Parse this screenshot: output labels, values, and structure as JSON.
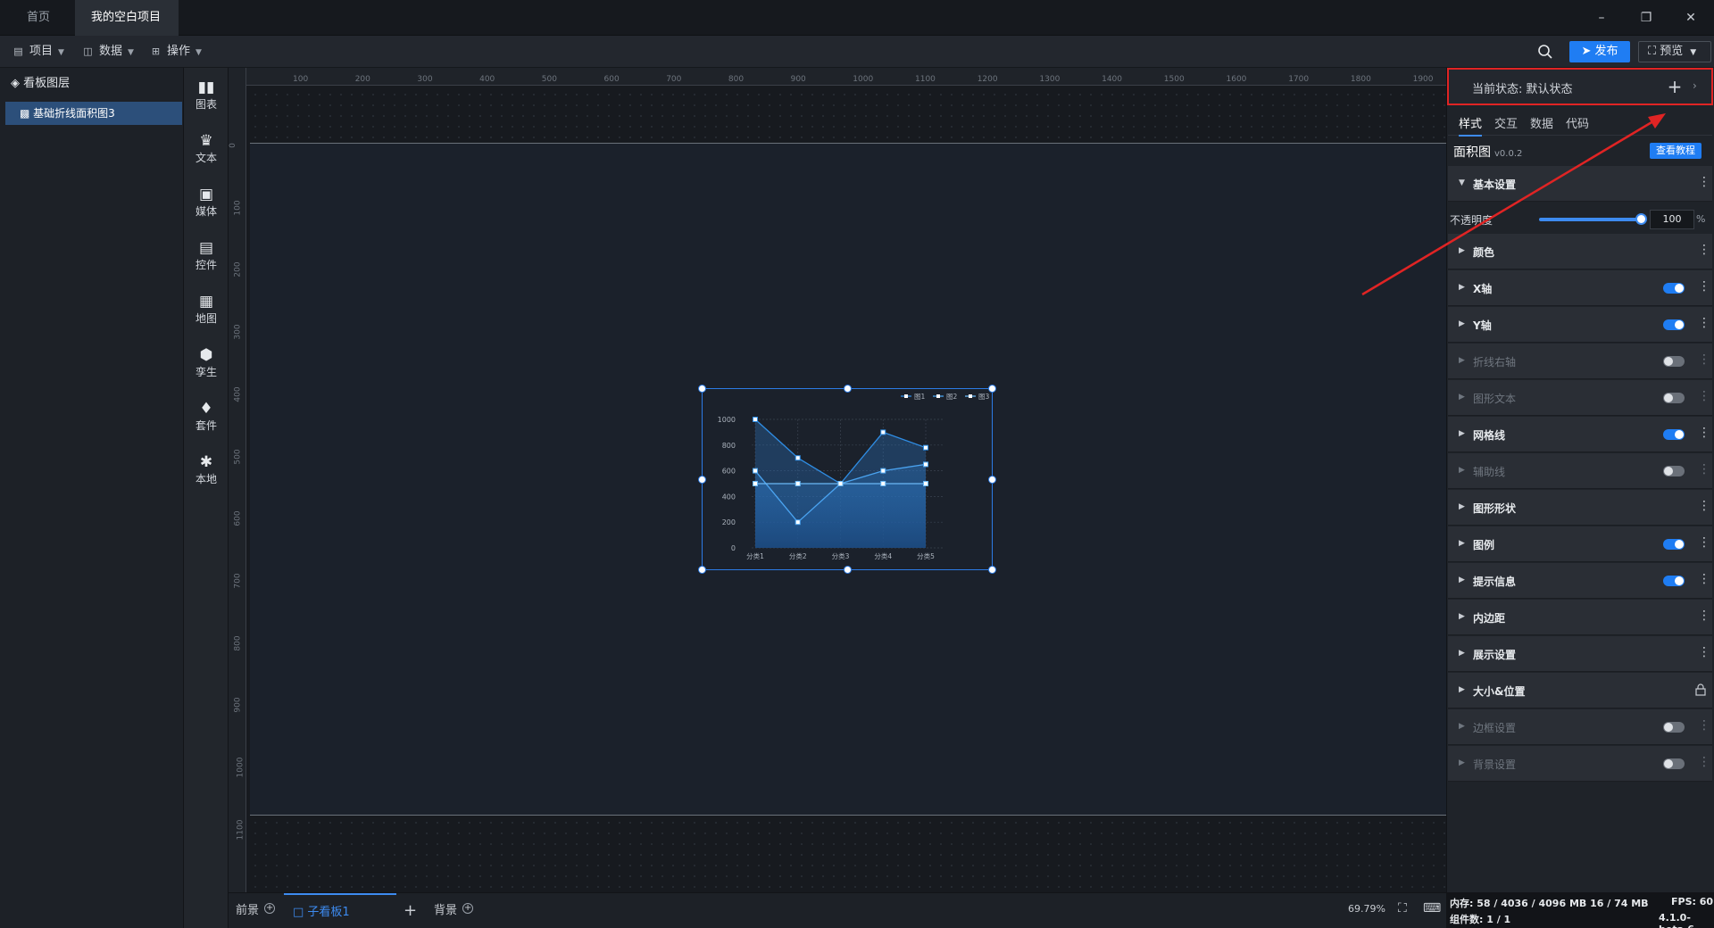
{
  "titlebar": {
    "tabs": [
      "首页",
      "我的空白项目"
    ]
  },
  "toolbar": {
    "menus": [
      "项目",
      "数据",
      "操作"
    ],
    "publish": "发布",
    "preview": "预览"
  },
  "layers": {
    "title": "看板图层",
    "item": "基础折线面积图3"
  },
  "tools": [
    "图表",
    "文本",
    "媒体",
    "控件",
    "地图",
    "孪生",
    "套件",
    "本地"
  ],
  "ruler": {
    "top_ticks": [
      "100",
      "200",
      "300",
      "400",
      "500",
      "600",
      "700",
      "800",
      "900",
      "1000",
      "1100",
      "1200",
      "1300",
      "1400",
      "1500",
      "1600",
      "1700",
      "1800",
      "1900"
    ],
    "left_ticks": [
      "0",
      "100",
      "200",
      "300",
      "400",
      "500",
      "600",
      "700",
      "800",
      "900",
      "1000",
      "1100"
    ]
  },
  "chart_data": {
    "type": "area",
    "categories": [
      "分类1",
      "分类2",
      "分类3",
      "分类4",
      "分类5"
    ],
    "series": [
      {
        "name": "图1",
        "values": [
          1000,
          700,
          500,
          900,
          780
        ]
      },
      {
        "name": "图2",
        "values": [
          600,
          200,
          500,
          600,
          650
        ]
      },
      {
        "name": "图3",
        "values": [
          500,
          500,
          500,
          500,
          500
        ]
      }
    ],
    "yticks": [
      "0",
      "200",
      "400",
      "600",
      "800",
      "1000"
    ],
    "ylim": [
      0,
      1000
    ],
    "legend": "top-right",
    "grid": true,
    "colors": [
      "#2f8de4",
      "#4aa3f0",
      "#6bb8f5"
    ]
  },
  "bottombar": {
    "tabs": [
      "前景",
      "子看板1",
      "背景"
    ],
    "zoom": "69.79%"
  },
  "rightpanel": {
    "state_label": "当前状态:  默认状态",
    "tabs": [
      "样式",
      "交互",
      "数据",
      "代码"
    ],
    "component": "面积图",
    "version": "v0.0.2",
    "tutorial": "查看教程",
    "opacity_label": "不透明度",
    "opacity_value": "100",
    "opacity_unit": "%",
    "sections": [
      {
        "name": "基本设置",
        "toggle": null,
        "dim": false,
        "open": true
      },
      {
        "name": "颜色",
        "toggle": null,
        "dim": false
      },
      {
        "name": "X轴",
        "toggle": "on",
        "dim": false
      },
      {
        "name": "Y轴",
        "toggle": "on",
        "dim": false
      },
      {
        "name": "折线右轴",
        "toggle": "off",
        "dim": true
      },
      {
        "name": "图形文本",
        "toggle": "off",
        "dim": true
      },
      {
        "name": "网格线",
        "toggle": "on",
        "dim": false
      },
      {
        "name": "辅助线",
        "toggle": "off",
        "dim": true
      },
      {
        "name": "图形形状",
        "toggle": null,
        "dim": false
      },
      {
        "name": "图例",
        "toggle": "on",
        "dim": false
      },
      {
        "name": "提示信息",
        "toggle": "on",
        "dim": false
      },
      {
        "name": "内边距",
        "toggle": null,
        "dim": false
      },
      {
        "name": "展示设置",
        "toggle": null,
        "dim": false
      },
      {
        "name": "大小&位置",
        "toggle": "lock",
        "dim": false
      },
      {
        "name": "边框设置",
        "toggle": "off",
        "dim": true
      },
      {
        "name": "背景设置",
        "toggle": "off",
        "dim": true
      }
    ]
  },
  "status": {
    "memory": "内存: 58 / 4036 / 4096 MB 16 / 74 MB",
    "fps": "FPS: 60",
    "components": "组件数: 1 / 1",
    "version": "4.1.0-beta.6"
  }
}
